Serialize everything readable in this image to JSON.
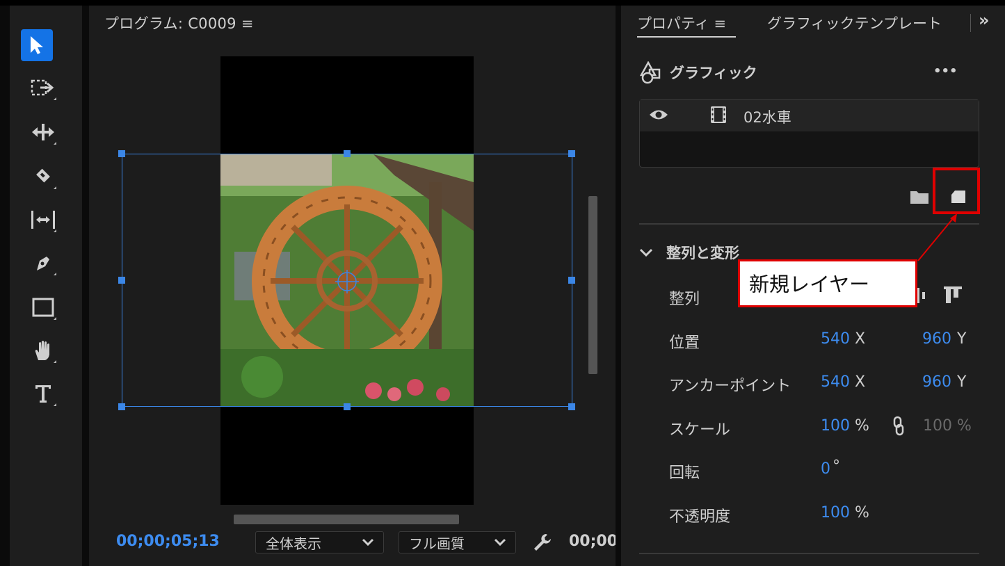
{
  "monitor": {
    "title": "プログラム: C0009 ≡",
    "timecode": "00;00;05;13",
    "zoom_select": "全体表示",
    "quality_select": "フル画質",
    "timecode_end": "00;00"
  },
  "tools": [
    "selection-tool",
    "track-select-tool",
    "ripple-edit-tool",
    "razor-tool",
    "slip-tool",
    "pen-tool",
    "rectangle-tool",
    "hand-tool",
    "type-tool"
  ],
  "properties": {
    "tab_properties": "プロパティ ≡",
    "tab_templates": "グラフィックテンプレート",
    "expand_label": "»",
    "section_graphic": "グラフィック",
    "more_label": "•••",
    "layer_name": "02水車",
    "section_align": "整列と変形",
    "rows": {
      "align_label": "整列",
      "position_label": "位置",
      "position_x": "540",
      "position_y": "960",
      "anchor_label": "アンカーポイント",
      "anchor_x": "540",
      "anchor_y": "960",
      "scale_label": "スケール",
      "scale_value": "100",
      "scale_value2": "100",
      "rotation_label": "回転",
      "rotation_value": "0",
      "opacity_label": "不透明度",
      "opacity_value": "100"
    },
    "units": {
      "x": "X",
      "y": "Y",
      "percent": "%",
      "degree": "°"
    }
  },
  "callout": {
    "text": "新規レイヤー",
    "border_color": "#e00000"
  },
  "colors": {
    "accent": "#3b86e6",
    "value_blue": "#3d8cf0",
    "panel_bg": "#1e1e1e"
  }
}
